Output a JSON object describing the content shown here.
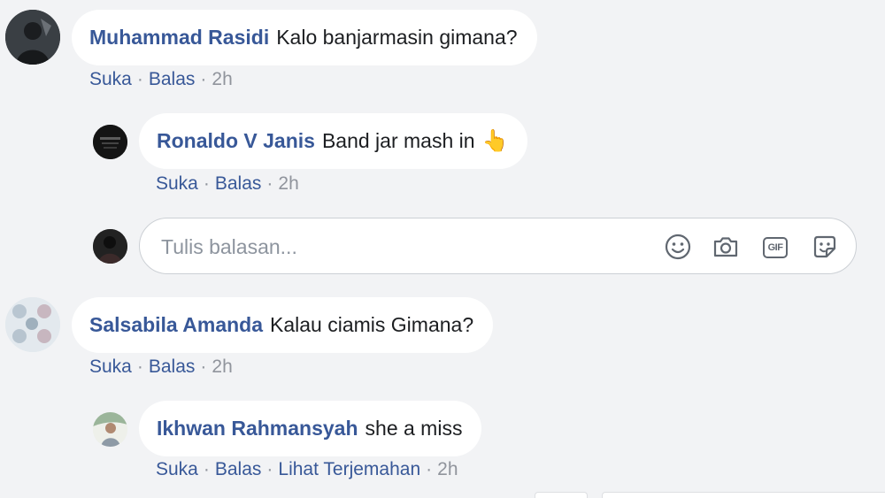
{
  "comments": [
    {
      "author": "Muhammad Rasidi",
      "text": "Kalo banjarmasin gimana?",
      "actions": {
        "like": "Suka",
        "reply": "Balas",
        "time": "2h"
      }
    },
    {
      "author": "Ronaldo V Janis",
      "text": "Band jar mash in",
      "emoji": "👆",
      "actions": {
        "like": "Suka",
        "reply": "Balas",
        "time": "2h"
      }
    },
    {
      "author": "Salsabila Amanda",
      "text": "Kalau ciamis Gimana?",
      "actions": {
        "like": "Suka",
        "reply": "Balas",
        "time": "2h"
      }
    },
    {
      "author": "Ikhwan Rahmansyah",
      "text": "she a miss",
      "actions": {
        "like": "Suka",
        "reply": "Balas",
        "translate": "Lihat Terjemahan",
        "time": "2h"
      }
    }
  ],
  "reply_box": {
    "placeholder": "Tulis balasan...",
    "icons": [
      "emoji-icon",
      "camera-icon",
      "gif-icon",
      "sticker-icon"
    ],
    "gif_label": "GIF"
  },
  "separator": "·",
  "colors": {
    "background": "#f2f3f5",
    "bubble": "#ffffff",
    "name": "#385898",
    "meta": "#90949c",
    "icon": "#606770"
  }
}
